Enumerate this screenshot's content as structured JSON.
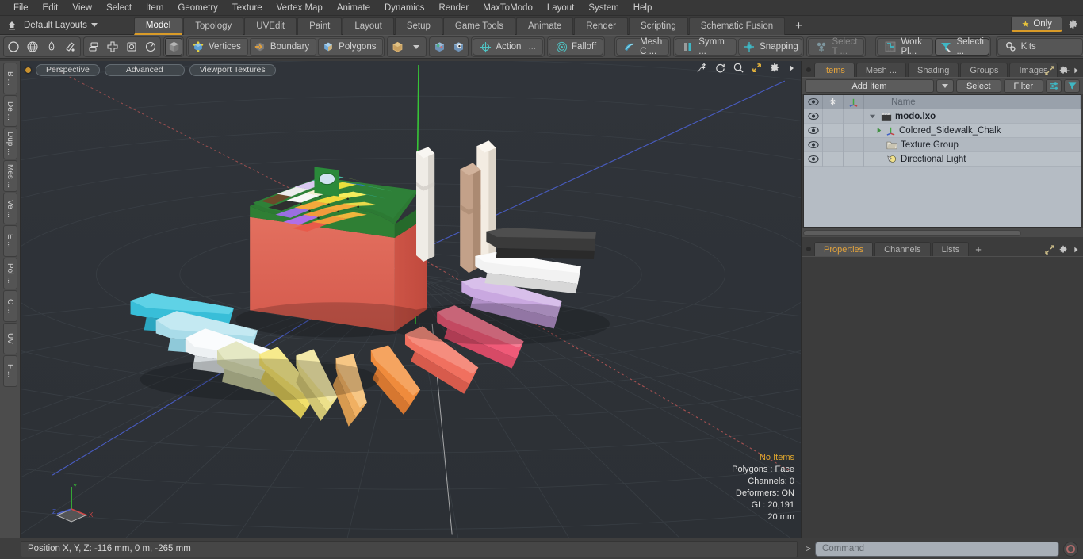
{
  "menu": {
    "items": [
      "File",
      "Edit",
      "View",
      "Select",
      "Item",
      "Geometry",
      "Texture",
      "Vertex Map",
      "Animate",
      "Dynamics",
      "Render",
      "MaxToModo",
      "Layout",
      "System",
      "Help"
    ]
  },
  "layout_bar": {
    "home_icon": "home-up-icon",
    "layout_name": "Default Layouts",
    "tabs": [
      {
        "label": "Model",
        "active": true
      },
      {
        "label": "Topology",
        "active": false
      },
      {
        "label": "UVEdit",
        "active": false
      },
      {
        "label": "Paint",
        "active": false
      },
      {
        "label": "Layout",
        "active": false
      },
      {
        "label": "Setup",
        "active": false
      },
      {
        "label": "Game Tools",
        "active": false
      },
      {
        "label": "Animate",
        "active": false
      },
      {
        "label": "Render",
        "active": false
      },
      {
        "label": "Scripting",
        "active": false
      },
      {
        "label": "Schematic Fusion",
        "active": false
      }
    ],
    "add_tab_label": "+",
    "only_label": "Only",
    "only_icon": "star-icon",
    "settings_icon": "gear-icon",
    "accent_color": "#d99b28"
  },
  "toolbar": {
    "group_primitives": [
      {
        "name": "circle-icon",
        "label": ""
      },
      {
        "name": "globe-icon",
        "label": ""
      },
      {
        "name": "pen-icon",
        "label": ""
      },
      {
        "name": "sculpt-icon",
        "label": ""
      }
    ],
    "group_transform": [
      {
        "name": "align-icon",
        "label": ""
      },
      {
        "name": "move-icon",
        "label": ""
      },
      {
        "name": "scale-icon",
        "label": ""
      },
      {
        "name": "rotate-icon",
        "label": ""
      }
    ],
    "group_selection": [
      {
        "name": "cube-icon",
        "label": ""
      },
      {
        "name": "vertices-icon",
        "label": "Vertices"
      },
      {
        "name": "boundary-icon",
        "label": "Boundary"
      },
      {
        "name": "polygons-icon",
        "label": "Polygons"
      }
    ],
    "group_mode": [
      {
        "name": "cube-solid-icon",
        "label": ""
      },
      {
        "name": "dropdown-arrow-icon",
        "label": ""
      }
    ],
    "group_shade": [
      {
        "name": "shade-a-icon",
        "label": ""
      },
      {
        "name": "shade-b-icon",
        "label": ""
      }
    ],
    "group_action": [
      {
        "name": "action-center-icon",
        "label": "Action"
      },
      {
        "name": "action-ellipsis",
        "label": "..."
      }
    ],
    "group_falloff": [
      {
        "name": "falloff-icon",
        "label": "Falloff"
      }
    ],
    "group_meshc": [
      {
        "name": "mesh-constraint-icon",
        "label": "Mesh C ..."
      }
    ],
    "group_symm": [
      {
        "name": "symmetry-icon",
        "label": "Symm ..."
      }
    ],
    "group_snap": [
      {
        "name": "snapping-icon",
        "label": "Snapping"
      }
    ],
    "group_selecttype": [
      {
        "name": "select-through-icon",
        "label": "Select T ...",
        "disabled": true
      }
    ],
    "group_workplane": [
      {
        "name": "work-plane-icon",
        "label": "Work Pl..."
      }
    ],
    "group_selecti": [
      {
        "name": "selection-set-icon",
        "label": "Selecti ..."
      }
    ],
    "group_kits": [
      {
        "name": "kits-gear-icon",
        "label": "Kits"
      }
    ],
    "group_engines": [
      {
        "name": "unity-icon",
        "label": ""
      },
      {
        "name": "unreal-icon",
        "label": ""
      }
    ]
  },
  "left_strip": {
    "tabs": [
      "B ...",
      "De ...",
      "Dup ...",
      "Mes ...",
      "Ve ...",
      "E ...",
      "Pol ...",
      "C ...",
      "UV",
      "F ..."
    ]
  },
  "viewport": {
    "pills": [
      "Perspective",
      "Advanced",
      "Viewport Textures"
    ],
    "corner_icons": [
      "move-view-icon",
      "rotate-view-icon",
      "zoom-view-icon",
      "fit-view-icon",
      "viewport-gear-icon",
      "viewport-more-icon"
    ],
    "stats": {
      "items": "No Items",
      "polygons": "Polygons : Face",
      "channels": "Channels: 0",
      "deformers": "Deformers: ON",
      "gl": "GL: 20,191",
      "grid": "20 mm"
    },
    "axis_labels": {
      "x": "X",
      "y": "Y",
      "z": "Z"
    },
    "background_color": "#2f3337",
    "grid_color": "#3c4247",
    "axis_x_color": "#b34b4b",
    "axis_y_color": "#3cc93c",
    "axis_z_color": "#4a5ecb"
  },
  "scene": {
    "box": {
      "front_color": "#e0695a",
      "side_color": "#d0584a",
      "band_color": "#1f7a30",
      "tab_color": "#2a8a3a",
      "swatches": [
        "#6b4a2a",
        "#e8e8e8",
        "#d9c8f0",
        "#2fb9a8",
        "#2f6fd0",
        "#3fae6a",
        "#3b3b3b",
        "#f5a93c",
        "#f3e23f",
        "#f5e850",
        "#2f8f4f",
        "#2f9b8f",
        "#b06fe8",
        "#e86fd0",
        "#e8533f",
        "#f08a3c",
        "#f0b43c",
        "#f0d23c"
      ]
    },
    "standing_chalks": [
      {
        "color": "#f0ece6",
        "name": "white-chalk-standing"
      },
      {
        "color": "#bfa088",
        "name": "brown-chalk-standing"
      },
      {
        "color": "#efe7dc",
        "name": "cream-chalk-standing"
      }
    ],
    "fan_chalks": [
      {
        "color": "#35bcd6",
        "name": "cyan-chalk"
      },
      {
        "color": "#a8dce8",
        "name": "light-blue-chalk"
      },
      {
        "color": "#eef1f2",
        "name": "white-chalk"
      },
      {
        "color": "#d6d9ae",
        "name": "pale-green-chalk"
      },
      {
        "color": "#f2e06a",
        "name": "yellow-chalk"
      },
      {
        "color": "#ece08a",
        "name": "pale-yellow-chalk"
      },
      {
        "color": "#f0b062",
        "name": "light-orange-chalk"
      },
      {
        "color": "#ef8b3c",
        "name": "orange-chalk"
      },
      {
        "color": "#f06a5a",
        "name": "salmon-chalk"
      },
      {
        "color": "#f05a78",
        "name": "pink-chalk"
      },
      {
        "color": "#c9a8e0",
        "name": "lavender-chalk"
      },
      {
        "color": "#f2f2f2",
        "name": "white-chalk-2"
      },
      {
        "color": "#3a3a3a",
        "name": "black-chalk"
      }
    ]
  },
  "right_panel": {
    "tabs": [
      {
        "label": "Items",
        "active": true
      },
      {
        "label": "Mesh ...",
        "active": false
      },
      {
        "label": "Shading",
        "active": false
      },
      {
        "label": "Groups",
        "active": false
      },
      {
        "label": "Images",
        "active": false
      }
    ],
    "add_tab_label": "+",
    "header_icons": [
      "expand-icon",
      "gear-icon",
      "more-arrow-icon"
    ],
    "toolbar": {
      "add_item_label": "Add Item",
      "add_item_arrow": "chevron-down-icon",
      "select_label": "Select",
      "filter_label": "Filter",
      "sort_icon": "sort-icon",
      "funnel_icon": "funnel-icon"
    },
    "list": {
      "columns": [
        "eye-icon",
        "lock-icon",
        "axis-icon",
        "Name"
      ],
      "name_header": "Name",
      "rows": [
        {
          "name": "modo.lxo",
          "icon": "scene-icon",
          "indent": 0,
          "bold": true,
          "expander": "expanded"
        },
        {
          "name": "Colored_Sidewalk_Chalk",
          "icon": "mesh-axis-icon",
          "indent": 1,
          "bold": false,
          "expander": "collapsed"
        },
        {
          "name": "Texture Group",
          "icon": "folder-icon",
          "indent": 1,
          "bold": false,
          "expander": "none"
        },
        {
          "name": "Directional Light",
          "icon": "light-icon",
          "indent": 1,
          "bold": false,
          "expander": "none"
        }
      ]
    },
    "properties_tabs": [
      {
        "label": "Properties",
        "active": true
      },
      {
        "label": "Channels",
        "active": false
      },
      {
        "label": "Lists",
        "active": false
      }
    ],
    "properties_add_label": "+"
  },
  "bottom": {
    "status_text": "Position X, Y, Z:   -116 mm, 0 m, -265 mm",
    "command_prompt": ">",
    "command_placeholder": "Command",
    "command_value": "",
    "record_icon": "record-icon"
  }
}
